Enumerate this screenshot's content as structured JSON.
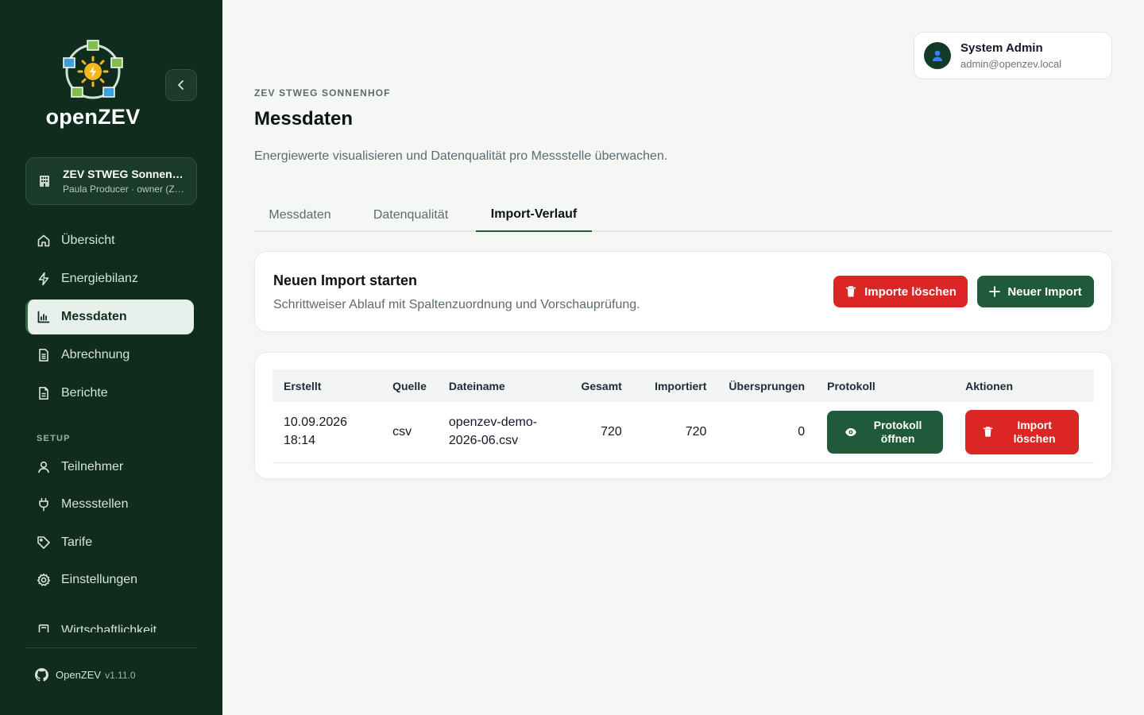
{
  "brand": {
    "name": "openZEV"
  },
  "zev": {
    "title": "ZEV STWEG Sonnenhof",
    "subtitle": "Paula Producer · owner (ZEV-Verwalter)"
  },
  "nav": {
    "main": [
      {
        "label": "Übersicht",
        "icon": "home-icon"
      },
      {
        "label": "Energiebilanz",
        "icon": "lightning-icon"
      },
      {
        "label": "Messdaten",
        "icon": "bar-chart-icon",
        "active": true
      },
      {
        "label": "Abrechnung",
        "icon": "document-icon"
      },
      {
        "label": "Berichte",
        "icon": "report-icon"
      }
    ],
    "section_label": "SETUP",
    "setup": [
      {
        "label": "Teilnehmer",
        "icon": "user-icon"
      },
      {
        "label": "Messstellen",
        "icon": "plug-icon"
      },
      {
        "label": "Tarife",
        "icon": "tag-icon"
      },
      {
        "label": "Einstellungen",
        "icon": "gear-icon"
      },
      {
        "label": "Wirtschaftlichkeit",
        "icon": "calculator-icon"
      }
    ]
  },
  "footer": {
    "product": "OpenZEV",
    "version": "v1.11.0"
  },
  "user": {
    "name": "System Admin",
    "email": "admin@openzev.local"
  },
  "page": {
    "eyebrow": "ZEV STWEG SONNENHOF",
    "title": "Messdaten",
    "description": "Energiewerte visualisieren und Datenqualität pro Messstelle überwachen."
  },
  "tabs": [
    {
      "label": "Messdaten"
    },
    {
      "label": "Datenqualität"
    },
    {
      "label": "Import-Verlauf",
      "active": true
    }
  ],
  "import_card": {
    "title": "Neuen Import starten",
    "subtitle": "Schrittweiser Ablauf mit Spaltenzuordnung und Vorschauprüfung.",
    "delete_label": "Importe löschen",
    "new_label": "Neuer Import"
  },
  "table": {
    "columns": [
      "Erstellt",
      "Quelle",
      "Dateiname",
      "Gesamt",
      "Importiert",
      "Übersprungen",
      "Protokoll",
      "Aktionen"
    ],
    "rows": [
      {
        "created_date": "10.09.2026",
        "created_time": "18:14",
        "source": "csv",
        "filename_a": "openzev-demo-",
        "filename_b": "2026-06.csv",
        "total": "720",
        "imported": "720",
        "skipped": "0",
        "protocol_label_a": "Protokoll",
        "protocol_label_b": "öffnen",
        "delete_label_a": "Import",
        "delete_label_b": "löschen"
      }
    ]
  },
  "colors": {
    "sidebar": "#0f2c1e",
    "accent": "#1f5a3a",
    "danger": "#dc2626"
  }
}
